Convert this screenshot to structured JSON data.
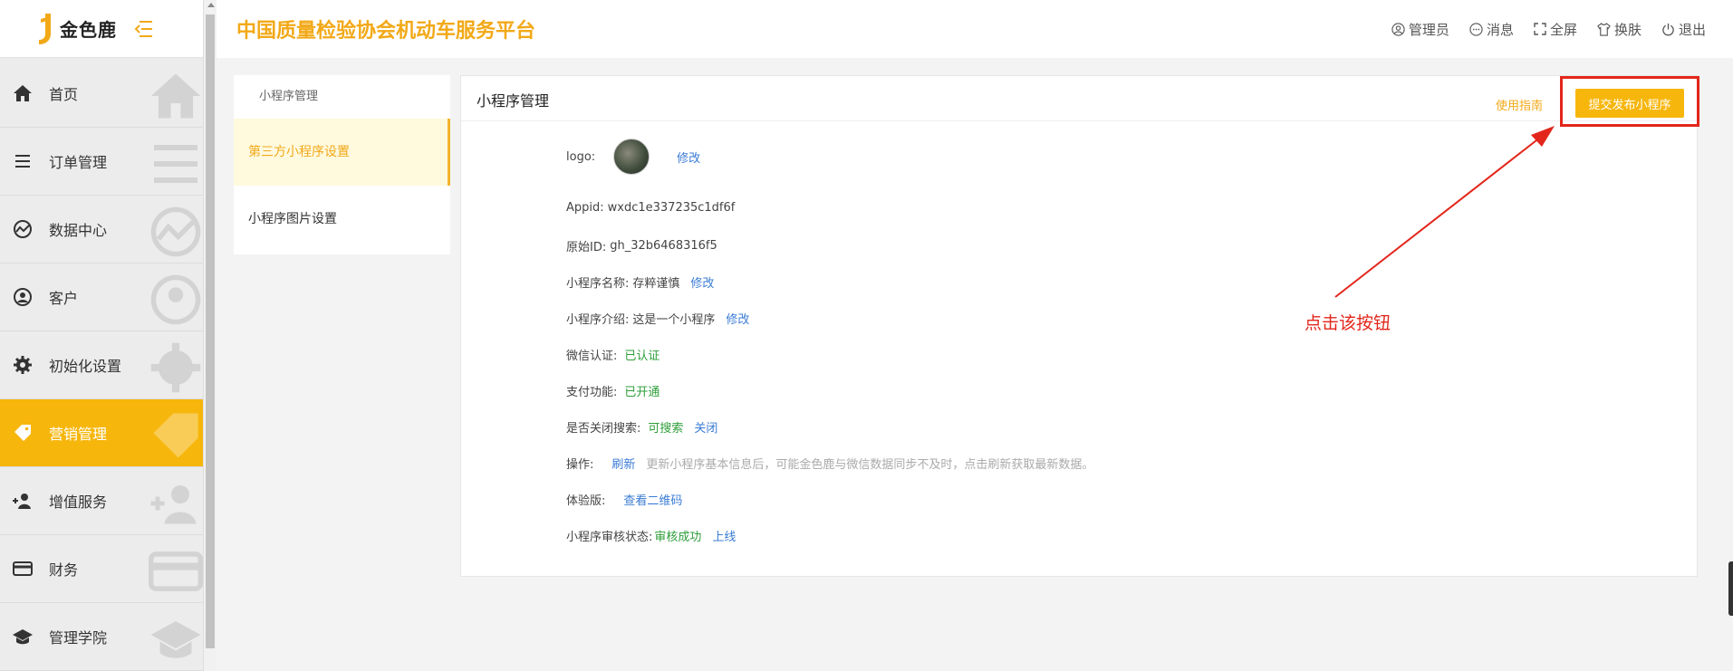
{
  "logo": {
    "text": "金色鹿"
  },
  "header": {
    "title": "中国质量检验协会机动车服务平台",
    "actions": [
      {
        "label": "管理员",
        "icon": "user-circle-icon"
      },
      {
        "label": "消息",
        "icon": "message-icon"
      },
      {
        "label": "全屏",
        "icon": "fullscreen-icon"
      },
      {
        "label": "换肤",
        "icon": "shirt-icon"
      },
      {
        "label": "退出",
        "icon": "power-icon"
      }
    ]
  },
  "sidebar": {
    "items": [
      {
        "label": "首页",
        "icon": "home-icon"
      },
      {
        "label": "订单管理",
        "icon": "list-icon"
      },
      {
        "label": "数据中心",
        "icon": "chart-icon"
      },
      {
        "label": "客户",
        "icon": "user-icon"
      },
      {
        "label": "初始化设置",
        "icon": "gear-icon"
      },
      {
        "label": "营销管理",
        "icon": "tag-icon",
        "active": true
      },
      {
        "label": "增值服务",
        "icon": "add-user-icon"
      },
      {
        "label": "财务",
        "icon": "card-icon"
      },
      {
        "label": "管理学院",
        "icon": "graduation-icon"
      }
    ]
  },
  "subnav": {
    "title": "小程序管理",
    "items": [
      {
        "label": "第三方小程序设置",
        "active": true
      },
      {
        "label": "小程序图片设置"
      }
    ]
  },
  "card": {
    "title": "小程序管理",
    "guide_label": "使用指南",
    "submit_label": "提交发布小程序",
    "logo_label": "logo:",
    "logo_edit": "修改",
    "appid_label": "Appid:",
    "appid_value": "wxdc1e337235c1df6f",
    "origin_label": "原始ID:",
    "origin_value": "gh_32b6468316f5",
    "name_label": "小程序名称:",
    "name_value": "存粹谨慎",
    "name_edit": "修改",
    "intro_label": "小程序介绍:",
    "intro_value": "这是一个小程序",
    "intro_edit": "修改",
    "wechat_label": "微信认证:",
    "wechat_value": "已认证",
    "pay_label": "支付功能:",
    "pay_value": "已开通",
    "search_label": "是否关闭搜索:",
    "search_value": "可搜索",
    "search_action": "关闭",
    "op_label": "操作:",
    "op_refresh": "刷新",
    "op_hint": "更新小程序基本信息后，可能金色鹿与微信数据同步不及时，点击刷新获取最新数据。",
    "trial_label": "体验版:",
    "trial_action": "查看二维码",
    "audit_label": "小程序审核状态:",
    "audit_value": "审核成功",
    "audit_action": "上线"
  },
  "annotation": {
    "text": "点击该按钮",
    "color": "#e3261b"
  },
  "colors": {
    "accent": "#f6b60c",
    "title": "#f2a918",
    "link": "#3a7bd5",
    "success": "#2e9e3a"
  }
}
